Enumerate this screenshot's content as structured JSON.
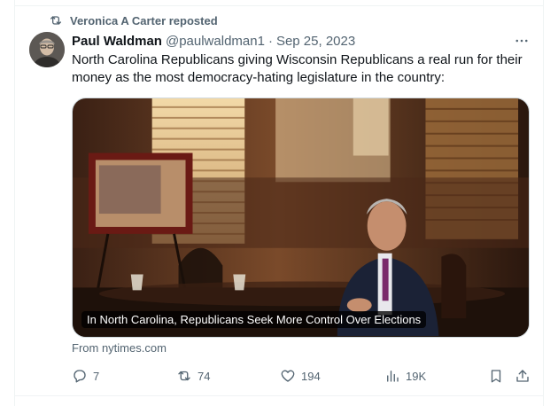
{
  "repost": {
    "label": "Veronica A Carter reposted",
    "icon": "repost-icon"
  },
  "author": {
    "name": "Paul Waldman",
    "handle": "@paulwaldman1",
    "separator": "·",
    "date": "Sep 25, 2023"
  },
  "tweet": {
    "text": "North Carolina Republicans giving Wisconsin Republicans a real run for their money as the most democracy-hating legislature in the country:"
  },
  "card": {
    "caption": "In North Carolina, Republicans Seek More Control Over Elections",
    "source": "From nytimes.com"
  },
  "actions": {
    "replies": "7",
    "reposts": "74",
    "likes": "194",
    "views": "19K"
  },
  "colors": {
    "text": "#0f1419",
    "muted": "#536471",
    "border": "#eff3f4"
  }
}
